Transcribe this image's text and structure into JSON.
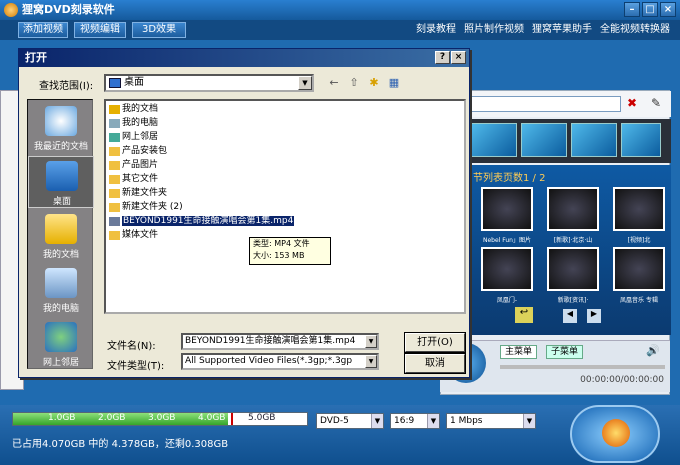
{
  "app": {
    "title": "狸窝DVD刻录软件"
  },
  "menu": {
    "tabs": [
      "添加视频",
      "视频编辑",
      "3D效果"
    ],
    "links": [
      "刻录教程",
      "照片制作视频",
      "狸窝苹果助手",
      "全能视频转换器"
    ]
  },
  "right_panel": {
    "preview_title": "节列表页数1 / 2",
    "captions": [
      "Nebel Fun」图片",
      "[新歌]·北京·山",
      "[视频]北",
      "凤凰门-",
      "新歌[资讯]·",
      "凤凰音乐 专辑"
    ],
    "main_menu": "主菜单",
    "sub_menu": "子菜单",
    "time": "00:00:00/00:00:00"
  },
  "bottom": {
    "ticks": [
      "1.0GB",
      "2.0GB",
      "3.0GB",
      "4.0GB",
      "5.0GB"
    ],
    "capacity_fraction": 0.73,
    "disc_type": "DVD-5",
    "aspect": "16:9",
    "bitrate": "1 Mbps",
    "usage_text": "已占用4.070GB 中的 4.378GB，还剩0.308GB"
  },
  "dialog": {
    "title": "打开",
    "look_in_label": "查找范围(I):",
    "look_in_value": "桌面",
    "places": [
      "我最近的文档",
      "桌面",
      "我的文档",
      "我的电脑",
      "网上邻居"
    ],
    "files": [
      "我的文档",
      "我的电脑",
      "网上邻居",
      "产品安装包",
      "产品图片",
      "其它文件",
      "新建文件夹",
      "新建文件夹 (2)",
      "BEYOND1991生命接触演唱会第1集.mp4",
      "媒体文件"
    ],
    "tooltip_type": "类型: MP4 文件",
    "tooltip_size": "大小: 153 MB",
    "filename_label": "文件名(N):",
    "filename_value": "BEYOND1991生命接触演唱会第1集.mp4",
    "filetype_label": "文件类型(T):",
    "filetype_value": "All Supported Video Files(*.3gp;*.3gp",
    "open_button": "打开(O)",
    "cancel_button": "取消"
  }
}
